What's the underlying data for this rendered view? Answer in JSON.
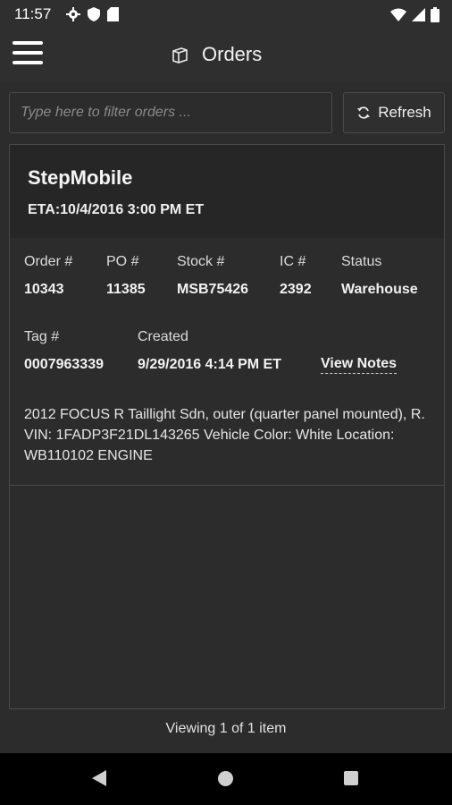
{
  "status_bar": {
    "time": "11:57",
    "left_icons": [
      "gear-icon",
      "shield-icon",
      "sd-card-icon"
    ],
    "right_icons": [
      "wifi-icon",
      "signal-icon",
      "battery-icon"
    ]
  },
  "app_bar": {
    "title": "Orders",
    "title_icon": "box-icon",
    "menu_icon": "hamburger-icon"
  },
  "filter": {
    "placeholder": "Type here to filter orders ...",
    "value": ""
  },
  "refresh": {
    "label": "Refresh",
    "icon": "refresh-icon"
  },
  "order": {
    "company": "StepMobile",
    "eta": "ETA:10/4/2016 3:00 PM ET",
    "labels": {
      "order_no": "Order #",
      "po_no": "PO #",
      "stock_no": "Stock #",
      "ic_no": "IC #",
      "status": "Status",
      "tag_no": "Tag #",
      "created": "Created"
    },
    "values": {
      "order_no": "10343",
      "po_no": "11385",
      "stock_no": "MSB75426",
      "ic_no": "2392",
      "status": "Warehouse",
      "tag_no": "0007963339",
      "created": "9/29/2016 4:14 PM ET"
    },
    "view_notes": "View Notes",
    "description": "2012 FOCUS R Taillight Sdn, outer (quarter panel mounted), R. VIN: 1FADP3F21DL143265 Vehicle Color: White Location: WB110102 ENGINE"
  },
  "footer": {
    "summary": "Viewing 1 of 1 item"
  },
  "colors": {
    "background": "#2c2c2c",
    "card_header": "#262626",
    "border": "#4a4a4a",
    "nav_bar": "#000000"
  }
}
